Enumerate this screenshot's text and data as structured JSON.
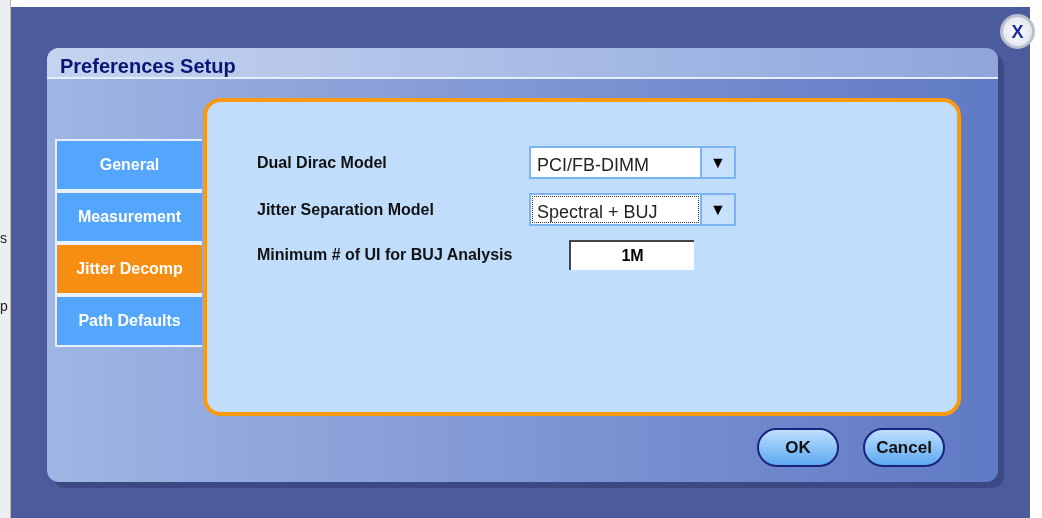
{
  "background_fragments": [
    "s",
    "p"
  ],
  "dialog": {
    "title": "Preferences Setup"
  },
  "tabs": [
    {
      "label": "General",
      "selected": false
    },
    {
      "label": "Measurement",
      "selected": false
    },
    {
      "label": "Jitter Decomp",
      "selected": true
    },
    {
      "label": "Path Defaults",
      "selected": false
    }
  ],
  "settings": [
    {
      "kind": "dropdown",
      "label": "Dual Dirac Model",
      "value": "PCI/FB-DIMM",
      "arrow": "▼",
      "focused": false
    },
    {
      "kind": "dropdown",
      "label": "Jitter Separation Model",
      "value": "Spectral + BUJ",
      "arrow": "▼",
      "focused": true
    },
    {
      "kind": "input",
      "label": "Minimum # of UI for BUJ Analysis",
      "value": "1M"
    }
  ],
  "buttons": [
    "OK",
    "Cancel"
  ],
  "close_button": "X"
}
